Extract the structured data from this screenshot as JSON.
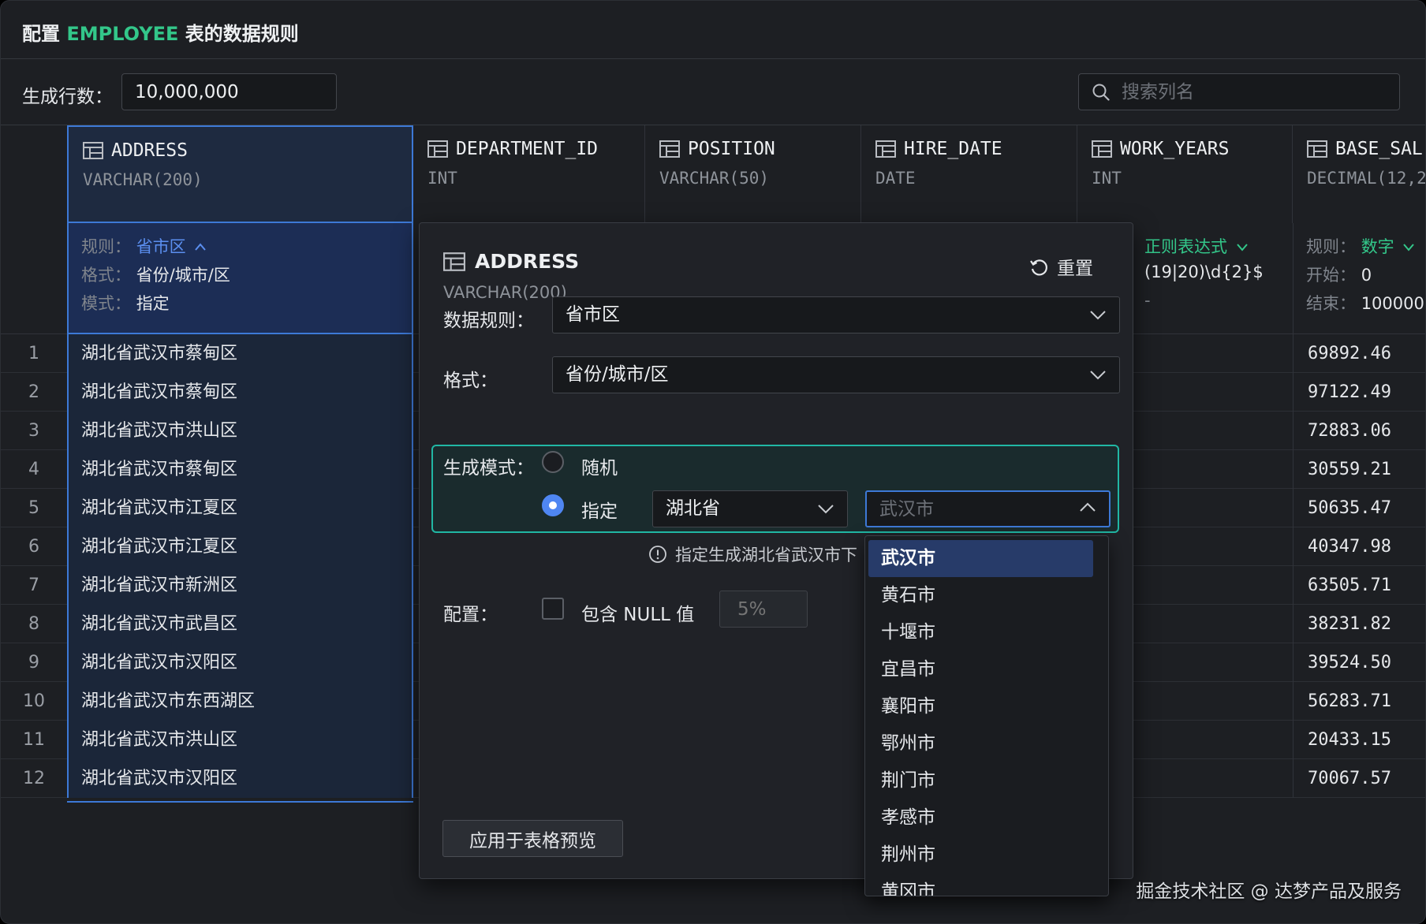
{
  "header": {
    "title_prefix": "配置 ",
    "title_table": "EMPLOYEE",
    "title_suffix": " 表的数据规则",
    "rows_label": "生成行数：",
    "rows_value": "10,000,000",
    "search_placeholder": "搜索列名"
  },
  "colors": {
    "accent_green": "#33c78a",
    "selection_blue": "#3d79d6",
    "focus_teal": "#21b7a4"
  },
  "columns": [
    {
      "name": "ADDRESS",
      "type": "VARCHAR(200)"
    },
    {
      "name": "DEPARTMENT_ID",
      "type": "INT"
    },
    {
      "name": "POSITION",
      "type": "VARCHAR(50)"
    },
    {
      "name": "HIRE_DATE",
      "type": "DATE"
    },
    {
      "name": "WORK_YEARS",
      "type": "INT"
    },
    {
      "name": "BASE_SAL",
      "type": "DECIMAL(12,2"
    }
  ],
  "rules": {
    "address": {
      "rule_label": "规则：",
      "rule_value": "省市区",
      "format_label": "格式：",
      "format_value": "省份/城市/区",
      "mode_label": "模式：",
      "mode_value": "指定"
    },
    "work_years": {
      "rule_value": "正则表达式",
      "regex": "(19|20)\\d{2}$",
      "extra": "-"
    },
    "base_sal": {
      "rule_label": "规则：",
      "rule_value": "数字",
      "start_label": "开始：",
      "start_value": "0",
      "end_label": "结束：",
      "end_value": "100000"
    }
  },
  "rows": [
    {
      "num": "1",
      "address": "湖北省武汉市蔡甸区",
      "salary": "69892.46"
    },
    {
      "num": "2",
      "address": "湖北省武汉市蔡甸区",
      "salary": "97122.49"
    },
    {
      "num": "3",
      "address": "湖北省武汉市洪山区",
      "salary": "72883.06"
    },
    {
      "num": "4",
      "address": "湖北省武汉市蔡甸区",
      "salary": "30559.21"
    },
    {
      "num": "5",
      "address": "湖北省武汉市江夏区",
      "salary": "50635.47"
    },
    {
      "num": "6",
      "address": "湖北省武汉市江夏区",
      "salary": "40347.98"
    },
    {
      "num": "7",
      "address": "湖北省武汉市新洲区",
      "salary": "63505.71"
    },
    {
      "num": "8",
      "address": "湖北省武汉市武昌区",
      "salary": "38231.82"
    },
    {
      "num": "9",
      "address": "湖北省武汉市汉阳区",
      "salary": "39524.50"
    },
    {
      "num": "10",
      "address": "湖北省武汉市东西湖区",
      "salary": "56283.71"
    },
    {
      "num": "11",
      "address": "湖北省武汉市洪山区",
      "salary": "20433.15"
    },
    {
      "num": "12",
      "address": "湖北省武汉市汉阳区",
      "salary": "70067.57"
    }
  ],
  "popover": {
    "title": "ADDRESS",
    "type": "VARCHAR(200)",
    "reset_label": "重置",
    "data_rule_label": "数据规则：",
    "data_rule_value": "省市区",
    "format_label": "格式：",
    "format_value": "省份/城市/区",
    "mode_label": "生成模式：",
    "mode_random": "随机",
    "mode_specified": "指定",
    "province_value": "湖北省",
    "city_placeholder": "武汉市",
    "hint": "指定生成湖北省武汉市下",
    "config_label": "配置：",
    "include_null_label": "包含 NULL 值",
    "null_pct_placeholder": "5%",
    "apply_label": "应用于表格预览"
  },
  "city_options": [
    "武汉市",
    "黄石市",
    "十堰市",
    "宜昌市",
    "襄阳市",
    "鄂州市",
    "荆门市",
    "孝感市",
    "荆州市",
    "黄冈市"
  ],
  "watermark": "掘金技术社区 @ 达梦产品及服务"
}
